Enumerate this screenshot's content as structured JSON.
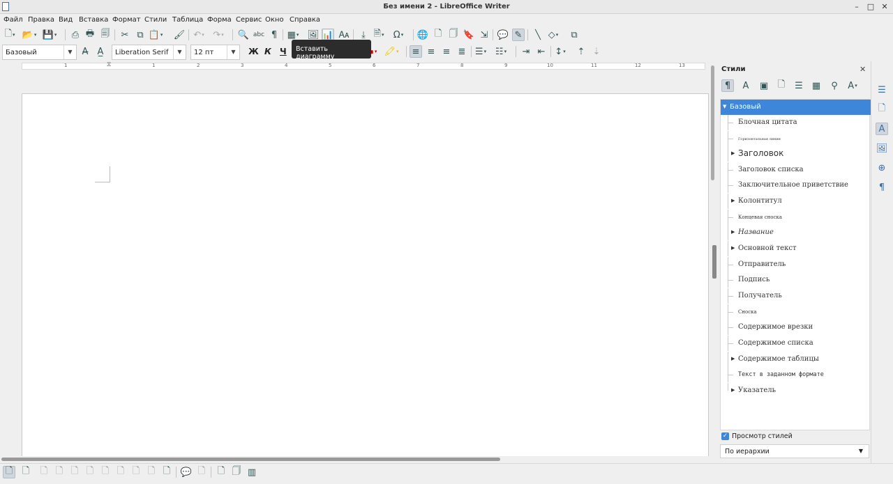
{
  "window": {
    "title": "Без имени 2 - LibreOffice Writer"
  },
  "menu": [
    "Файл",
    "Правка",
    "Вид",
    "Вставка",
    "Формат",
    "Стили",
    "Таблица",
    "Форма",
    "Сервис",
    "Окно",
    "Справка"
  ],
  "formatting": {
    "paragraph_style": "Базовый",
    "font_name": "Liberation Serif",
    "font_size": "12 пт",
    "bold_label": "Ж",
    "italic_label": "К",
    "underline_label": "Ч"
  },
  "tooltip": {
    "text": "Вставить диаграмму"
  },
  "ruler": {
    "numbers": [
      "1",
      "1",
      "2",
      "3",
      "4",
      "5",
      "6",
      "7",
      "8",
      "9",
      "10",
      "11",
      "12",
      "13"
    ]
  },
  "sidebar": {
    "title": "Стили",
    "styles": [
      {
        "label": "Базовый",
        "expandable": true,
        "selected": true
      },
      {
        "label": "Блочная цитата",
        "expandable": false
      },
      {
        "label": "Горизонтальная линия",
        "expandable": false,
        "tiny": true
      },
      {
        "label": "Заголовок",
        "expandable": true,
        "large": true
      },
      {
        "label": "Заголовок списка",
        "expandable": false
      },
      {
        "label": "Заключительное приветствие",
        "expandable": false
      },
      {
        "label": "Колонтитул",
        "expandable": true
      },
      {
        "label": "Концевая сноска",
        "expandable": false,
        "small": true
      },
      {
        "label": "Название",
        "expandable": true,
        "italic": true
      },
      {
        "label": "Основной текст",
        "expandable": true
      },
      {
        "label": "Отправитель",
        "expandable": false
      },
      {
        "label": "Подпись",
        "expandable": false
      },
      {
        "label": "Получатель",
        "expandable": false
      },
      {
        "label": "Сноска",
        "expandable": false,
        "small": true
      },
      {
        "label": "Содержимое врезки",
        "expandable": false
      },
      {
        "label": "Содержимое списка",
        "expandable": false
      },
      {
        "label": "Содержимое таблицы",
        "expandable": true
      },
      {
        "label": "Текст в заданном формате",
        "expandable": false,
        "mono": true
      },
      {
        "label": "Указатель",
        "expandable": true
      }
    ],
    "preview_label": "Просмотр стилей",
    "preview_checked": true,
    "filter_value": "По иерархии"
  },
  "colors": {
    "accent": "#3d86d9",
    "tooltip_bg": "#2c2c2c"
  }
}
